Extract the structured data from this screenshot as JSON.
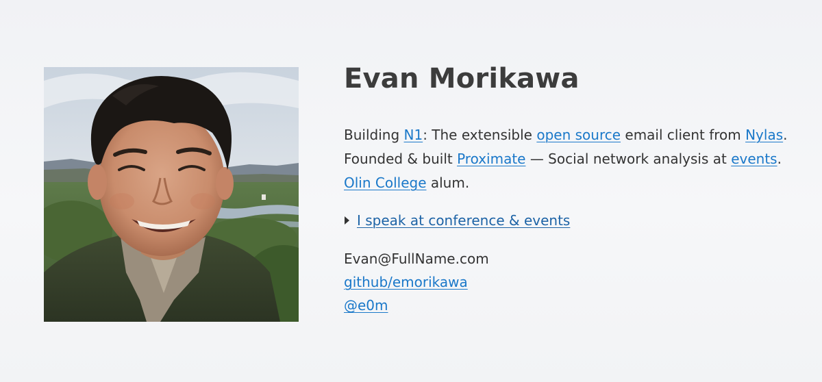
{
  "profile": {
    "name": "Evan Morikawa",
    "photo_alt": "Portrait photo"
  },
  "bio": {
    "line1": {
      "prefix": "Building ",
      "link1": "N1",
      "mid1": ": The extensible ",
      "link2": "open source",
      "mid2": " email client from ",
      "link3": "Nylas",
      "suffix": "."
    },
    "line2": {
      "prefix": "Founded & built ",
      "link1": "Proximate",
      "mid1": " — Social network analysis at ",
      "link2": "events",
      "suffix": "."
    },
    "line3": {
      "link1": "Olin College",
      "suffix": " alum."
    }
  },
  "speaking": {
    "label": "I speak at conference & events"
  },
  "contact": {
    "email": "Evan@FullName.com",
    "github": "github/emorikawa",
    "twitter": "@e0m"
  },
  "colors": {
    "link": "#1a78c9",
    "text": "#333333",
    "heading": "#3c3c3c",
    "background": "#f3f4f6"
  }
}
